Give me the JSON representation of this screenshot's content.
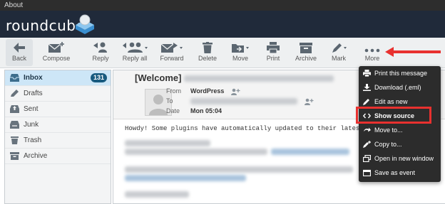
{
  "window": {
    "title": "About"
  },
  "brand": {
    "name": "roundcube"
  },
  "toolbar": {
    "back": "Back",
    "compose": "Compose",
    "reply": "Reply",
    "reply_all": "Reply all",
    "forward": "Forward",
    "delete": "Delete",
    "move": "Move",
    "print": "Print",
    "archive": "Archive",
    "mark": "Mark",
    "more": "More"
  },
  "folders": [
    {
      "label": "Inbox",
      "count": "131",
      "icon": "inbox-icon"
    },
    {
      "label": "Drafts",
      "icon": "pencil-icon"
    },
    {
      "label": "Sent",
      "icon": "sent-icon"
    },
    {
      "label": "Junk",
      "icon": "junk-icon"
    },
    {
      "label": "Trash",
      "icon": "trash-icon"
    },
    {
      "label": "Archive",
      "icon": "archive-icon"
    }
  ],
  "message": {
    "subject_prefix": "[Welcome]",
    "from_label": "From",
    "from_value": "WordPress",
    "to_label": "To",
    "date_label": "Date",
    "date_value": "Mon 05:04",
    "body_first_line": "Howdy! Some plugins have automatically updated to their latest ver"
  },
  "more_menu": [
    {
      "label": "Print this message",
      "icon": "print-icon"
    },
    {
      "label": "Download (.eml)",
      "icon": "download-icon"
    },
    {
      "label": "Edit as new",
      "icon": "edit-icon"
    },
    {
      "label": "Show source",
      "icon": "code-icon"
    },
    {
      "label": "Move to...",
      "icon": "move-icon"
    },
    {
      "label": "Copy to...",
      "icon": "copy-icon"
    },
    {
      "label": "Open in new window",
      "icon": "new-window-icon"
    },
    {
      "label": "Save as event",
      "icon": "calendar-icon"
    }
  ],
  "colors": {
    "header": "#202a3a",
    "accent": "#175a7f",
    "highlight": "#e8312f",
    "menu": "#2c2c2c"
  }
}
